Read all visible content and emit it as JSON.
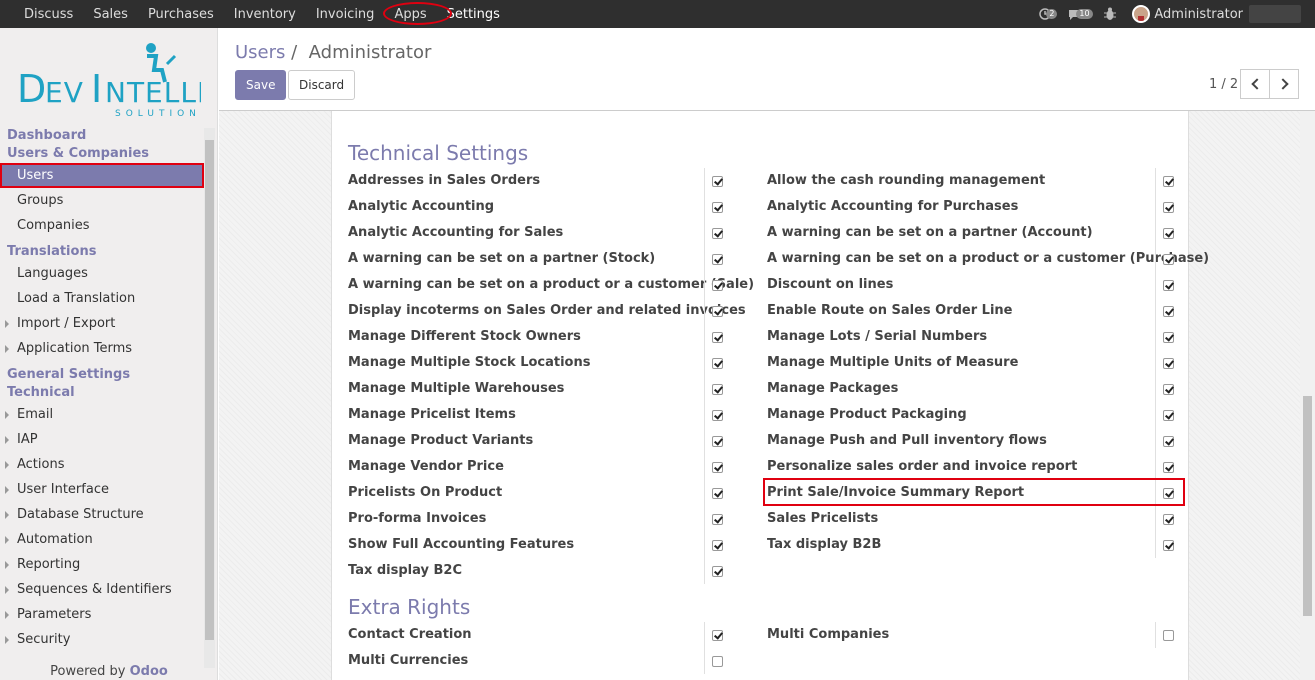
{
  "topbar": {
    "menu": [
      "Discuss",
      "Sales",
      "Purchases",
      "Inventory",
      "Invoicing",
      "Apps",
      "Settings"
    ],
    "activity_count": "2",
    "message_count": "10",
    "user_name": "Administrator"
  },
  "logo": {
    "brand": "DevIntelle",
    "tagline": "SOLUTIONS"
  },
  "sidebar": {
    "head_dashboard": "Dashboard",
    "head_users_companies": "Users & Companies",
    "users": "Users",
    "groups": "Groups",
    "companies": "Companies",
    "head_translations": "Translations",
    "languages": "Languages",
    "load_translation": "Load a Translation",
    "import_export": "Import / Export",
    "application_terms": "Application Terms",
    "head_general_settings": "General Settings",
    "head_technical": "Technical",
    "email": "Email",
    "iap": "IAP",
    "actions": "Actions",
    "user_interface": "User Interface",
    "database_structure": "Database Structure",
    "automation": "Automation",
    "reporting": "Reporting",
    "sequences": "Sequences & Identifiers",
    "parameters": "Parameters",
    "security": "Security"
  },
  "powered": {
    "prefix": "Powered by",
    "brand": "Odoo"
  },
  "control": {
    "breadcrumb_parent": "Users",
    "breadcrumb_sep": "/",
    "breadcrumb_current": "Administrator",
    "save": "Save",
    "discard": "Discard",
    "pager": "1 / 2"
  },
  "technical": {
    "title": "Technical Settings",
    "left": [
      [
        "Addresses in Sales Orders",
        true
      ],
      [
        "Analytic Accounting",
        true
      ],
      [
        "Analytic Accounting for Sales",
        true
      ],
      [
        "A warning can be set on a partner (Stock)",
        true
      ],
      [
        "A warning can be set on a product or a customer (Sale)",
        true
      ],
      [
        "Display incoterms on Sales Order and related invoices",
        true
      ],
      [
        "Manage Different Stock Owners",
        true
      ],
      [
        "Manage Multiple Stock Locations",
        true
      ],
      [
        "Manage Multiple Warehouses",
        true
      ],
      [
        "Manage Pricelist Items",
        true
      ],
      [
        "Manage Product Variants",
        true
      ],
      [
        "Manage Vendor Price",
        true
      ],
      [
        "Pricelists On Product",
        true
      ],
      [
        "Pro-forma Invoices",
        true
      ],
      [
        "Show Full Accounting Features",
        true
      ],
      [
        "Tax display B2C",
        true
      ]
    ],
    "right": [
      [
        "Allow the cash rounding management",
        true
      ],
      [
        "Analytic Accounting for Purchases",
        true
      ],
      [
        "A warning can be set on a partner (Account)",
        true
      ],
      [
        "A warning can be set on a product or a customer (Purchase)",
        true
      ],
      [
        "Discount on lines",
        true
      ],
      [
        "Enable Route on Sales Order Line",
        true
      ],
      [
        "Manage Lots / Serial Numbers",
        true
      ],
      [
        "Manage Multiple Units of Measure",
        true
      ],
      [
        "Manage Packages",
        true
      ],
      [
        "Manage Product Packaging",
        true
      ],
      [
        "Manage Push and Pull inventory flows",
        true
      ],
      [
        "Personalize sales order and invoice report",
        true
      ],
      [
        "Print Sale/Invoice Summary Report",
        true
      ],
      [
        "Sales Pricelists",
        true
      ],
      [
        "Tax display B2B",
        true
      ]
    ]
  },
  "extra": {
    "title": "Extra Rights",
    "left": [
      [
        "Contact Creation",
        true
      ],
      [
        "Multi Currencies",
        false
      ]
    ],
    "right": [
      [
        "Multi Companies",
        false
      ]
    ]
  }
}
